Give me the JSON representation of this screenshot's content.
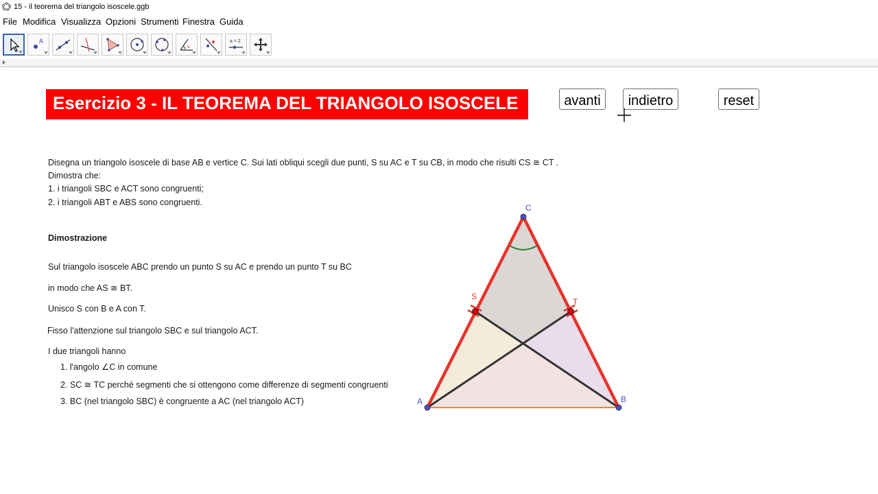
{
  "window": {
    "title": "15 - il teorema del triangolo isoscele.ggb"
  },
  "menu": [
    "File",
    "Modifica",
    "Visualizza",
    "Opzioni",
    "Strumenti",
    "Finestra",
    "Guida"
  ],
  "toolbar": {
    "tools": [
      {
        "name": "move-tool-icon"
      },
      {
        "name": "point-tool-icon"
      },
      {
        "name": "line-tool-icon"
      },
      {
        "name": "perpendicular-tool-icon"
      },
      {
        "name": "polygon-tool-icon"
      },
      {
        "name": "circle-tool-icon"
      },
      {
        "name": "circle-three-points-tool-icon"
      },
      {
        "name": "angle-tool-icon"
      },
      {
        "name": "reflect-tool-icon"
      },
      {
        "name": "slider-tool-icon"
      },
      {
        "name": "move-view-tool-icon"
      }
    ],
    "slider_label": "a = 2"
  },
  "banner": {
    "title": "Esercizio 3 - IL TEOREMA DEL TRIANGOLO ISOSCELE"
  },
  "buttons": {
    "avanti": "avanti",
    "indietro": "indietro",
    "reset": "reset"
  },
  "problem": {
    "line1": "Disegna un triangolo isoscele di base AB e vertice C. Sui lati obliqui scegli due punti, S su AC e T su CB, in modo che risulti CS ≅ CT .",
    "line2": "Dimostra che:",
    "line3": "1. i triangoli SBC e ACT sono congruenti;",
    "line4": "2. i triangoli ABT e ABS sono congruenti."
  },
  "proof": {
    "heading": "Dimostrazione",
    "p1": "Sul triangolo isoscele ABC prendo un punto S su AC  e prendo un punto T su BC",
    "p2": "in modo che AS ≅ BT.",
    "p3": "Unisco S con B  e A con T.",
    "p4": "Fisso l'attenzione sul triangolo SBC e sul triangolo ACT.",
    "p5": "I due triangoli hanno",
    "items": [
      "1. l'angolo ∠C in comune",
      "2. SC ≅ TC perchè segmenti che si ottengono come differenze di segmenti congruenti",
      "3. BC (nel triangolo SBC) è congruente a AC (nel triangolo ACT)"
    ]
  },
  "figure": {
    "labels": {
      "A": "A",
      "B": "B",
      "C": "C",
      "S": "S",
      "T": "T"
    },
    "colors": {
      "triangle_side": "#e8332a",
      "base": "#e08a3a",
      "point": "#4a50c8",
      "point_on_side": "#e00000",
      "segments": "#333333",
      "angle_arc": "#2e7d32",
      "fill_ABC": "#f3e2e2",
      "fill_SBC": "#e6dcef",
      "fill_ACT": "#f3ecd8",
      "fill_top": "#d9d4d4"
    }
  }
}
